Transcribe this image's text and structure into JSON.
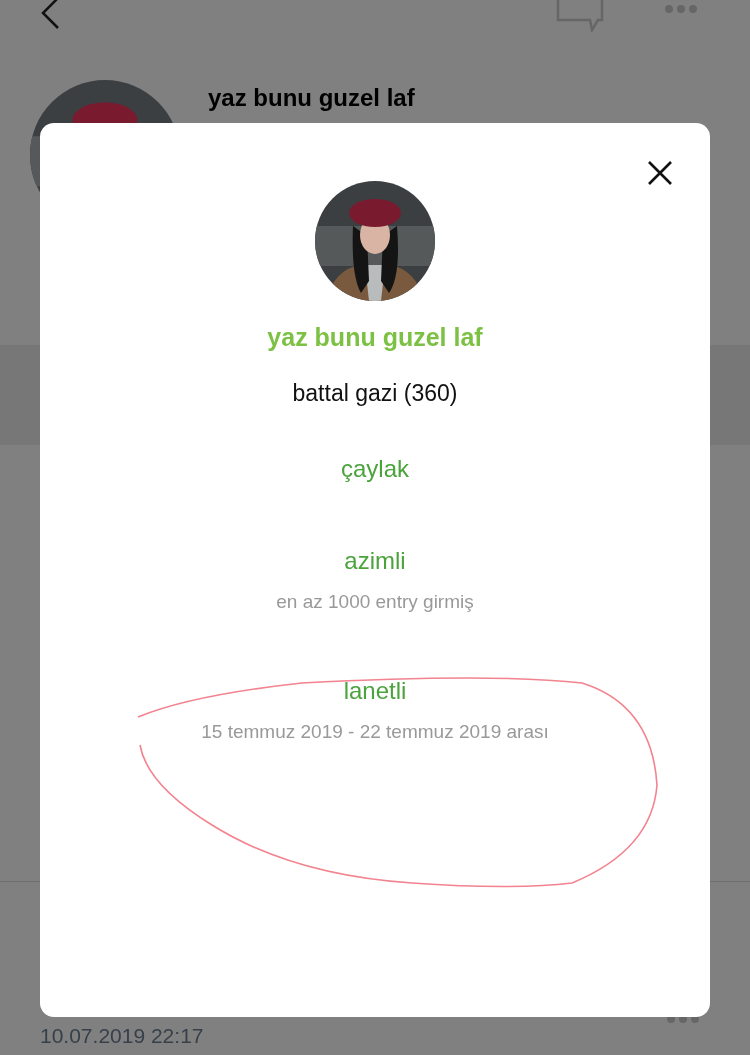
{
  "background": {
    "title": "yaz bunu guzel laf",
    "entry_date": "10.07.2019 22:17"
  },
  "modal": {
    "name": "yaz bunu guzel laf",
    "subtitle": "battal gazi (360)",
    "badges": [
      {
        "title": "çaylak"
      },
      {
        "title": "azimli",
        "description": "en az 1000 entry girmiş"
      },
      {
        "title": "lanetli",
        "description": "15 temmuz 2019 - 22 temmuz 2019 arası"
      }
    ]
  }
}
